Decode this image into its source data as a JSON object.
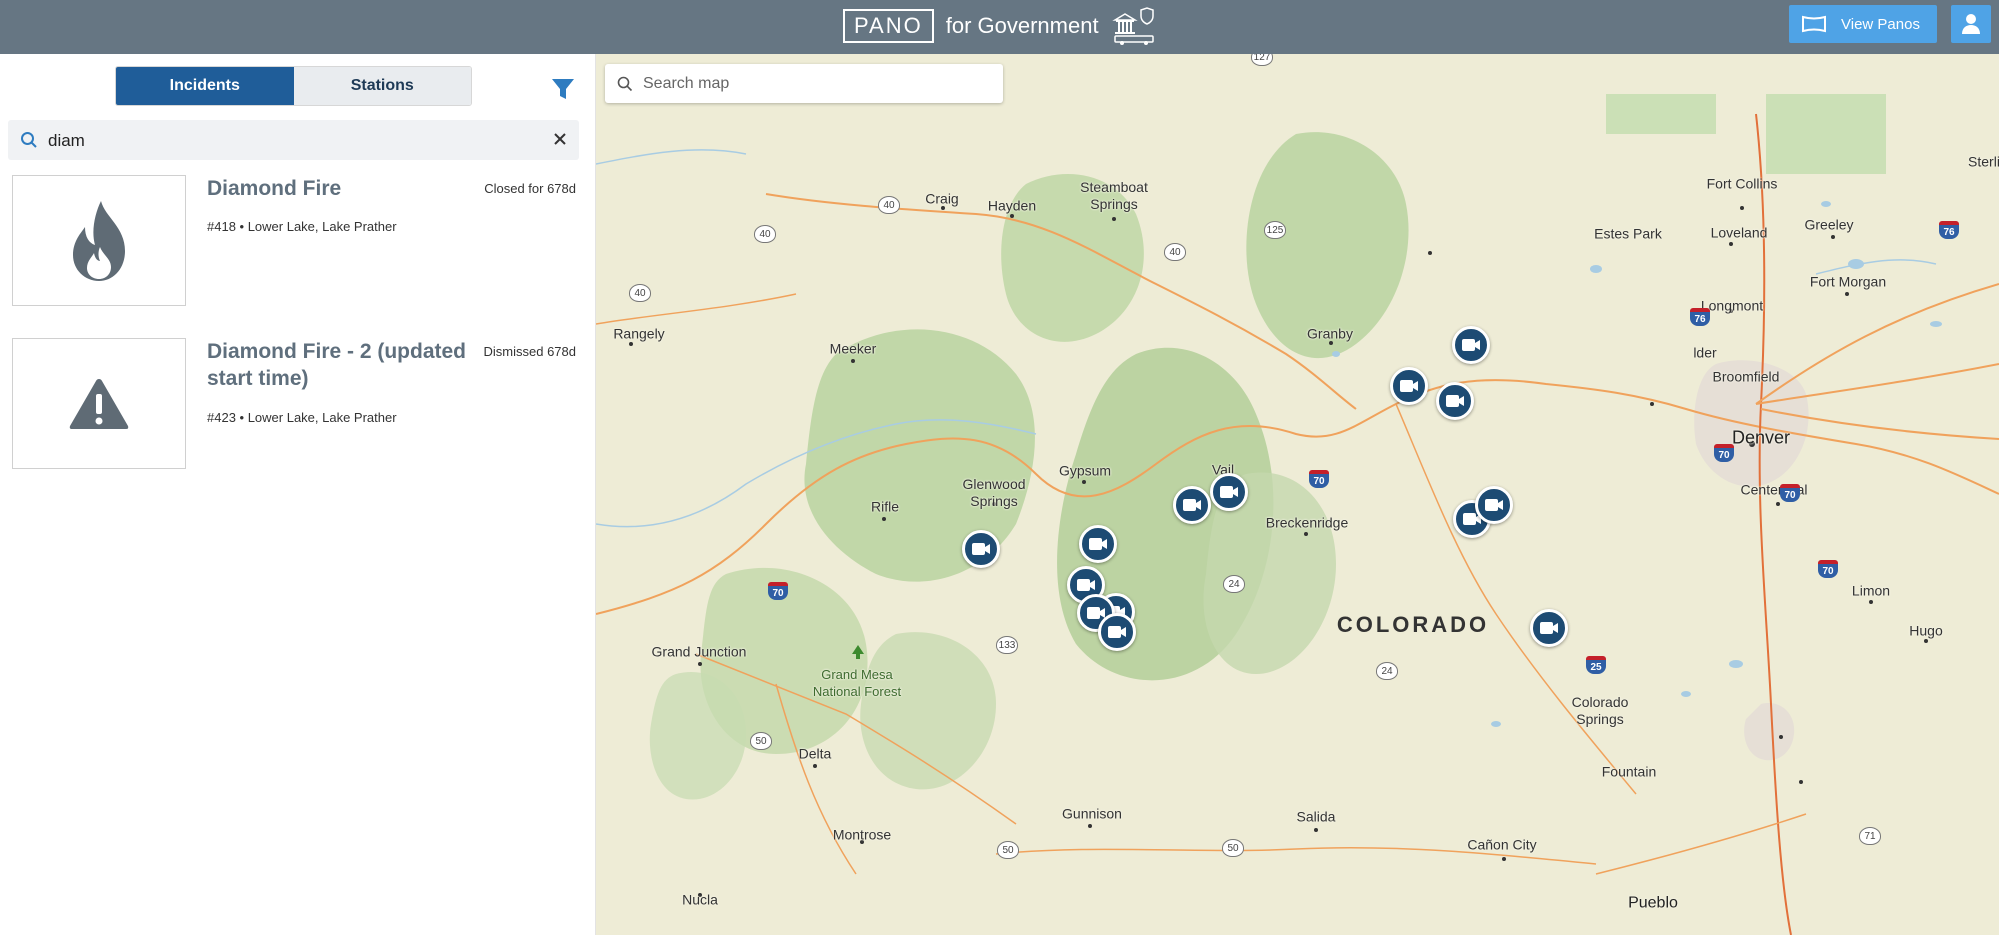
{
  "header": {
    "brand_box": "PANO",
    "brand_text": "for Government",
    "view_panos_label": "View Panos"
  },
  "sidebar": {
    "tabs": [
      {
        "label": "Incidents",
        "active": true
      },
      {
        "label": "Stations",
        "active": false
      }
    ],
    "search_value": "diam",
    "results": [
      {
        "title": "Diamond Fire",
        "status": "Closed for 678d",
        "meta": "#418 • Lower Lake, Lake Prather",
        "icon": "fire-icon"
      },
      {
        "title": "Diamond Fire - 2 (updated start time)",
        "status": "Dismissed 678d",
        "meta": "#423 • Lower Lake, Lake Prather",
        "icon": "warning-icon"
      }
    ]
  },
  "map": {
    "search_placeholder": "Search map",
    "state_label": "COLORADO",
    "places": {
      "craig": "Craig",
      "hayden": "Hayden",
      "steamboat": "Steamboat Springs",
      "fort_collins": "Fort Collins",
      "greeley": "Greeley",
      "loveland": "Loveland",
      "estes_park": "Estes Park",
      "sterling": "Sterli",
      "fort_morgan": "Fort Morgan",
      "longmont": "Longmont",
      "boulder": "lder",
      "broomfield": "Broomfield",
      "denver": "Denver",
      "centennial": "Centennial",
      "rangely": "Rangely",
      "meeker": "Meeker",
      "granby": "Granby",
      "vail": "Vail",
      "glenwood": "Glenwood Springs",
      "gypsum": "Gypsum",
      "rifle": "Rifle",
      "breckenridge": "Breckenridge",
      "limon": "Limon",
      "hugo": "Hugo",
      "grand_junction": "Grand Junction",
      "grand_mesa": "Grand Mesa National Forest",
      "colorado_springs": "Colorado Springs",
      "fountain": "Fountain",
      "delta": "Delta",
      "montrose": "Montrose",
      "gunnison": "Gunnison",
      "salida": "Salida",
      "canon_city": "Cañon City",
      "nucla": "Nucla",
      "pueblo": "Pueblo"
    },
    "routes": {
      "r127": "127",
      "r40a": "40",
      "r40b": "40",
      "r40c": "40",
      "r40d": "40",
      "r125": "125",
      "r70a": "70",
      "r70b": "70",
      "r70c": "70",
      "r70d": "70",
      "r70e": "70",
      "r76a": "76",
      "r76b": "76",
      "r24a": "24",
      "r24b": "24",
      "r133": "133",
      "r50a": "50",
      "r50b": "50",
      "r50c": "50",
      "r25": "25",
      "r71": "71"
    }
  }
}
